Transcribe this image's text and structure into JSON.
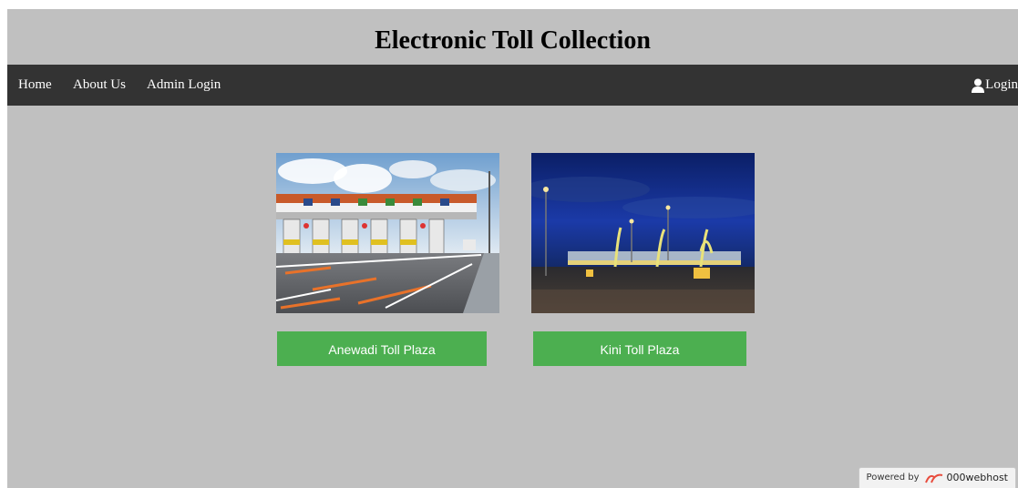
{
  "header": {
    "title": "Electronic Toll Collection"
  },
  "nav": {
    "home": "Home",
    "about": "About Us",
    "admin_login": "Admin Login",
    "login": "Login",
    "login_icon": "user-icon"
  },
  "plazas": [
    {
      "label": "Anewadi Toll Plaza"
    },
    {
      "label": "Kini Toll Plaza"
    }
  ],
  "footer": {
    "powered_by": "Powered by",
    "host": "000webhost",
    "host_icon": "000webhost-logo-icon"
  },
  "colors": {
    "page_background": "#c0c0c0",
    "navbar": "#333333",
    "button": "#4caf50",
    "button_text": "#ffffff"
  }
}
